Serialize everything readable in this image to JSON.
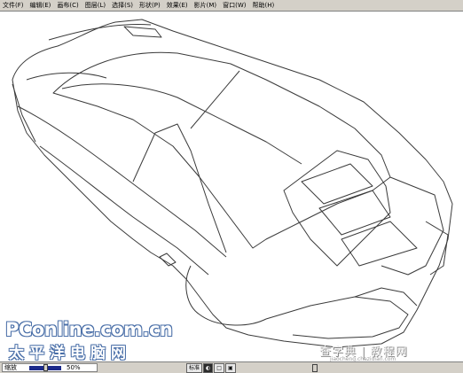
{
  "menubar": {
    "items": [
      "文件(F)",
      "编辑(E)",
      "画布(C)",
      "图层(L)",
      "选择(S)",
      "形状(P)",
      "效果(E)",
      "影片(M)",
      "窗口(W)",
      "帮助(H)"
    ]
  },
  "statusbar": {
    "zoom_label": "缩放",
    "zoom_percent": "50%",
    "zoom_level": 0.5,
    "dock_buttons": [
      "标准",
      "◐",
      "□",
      "▣"
    ]
  },
  "watermarks": {
    "site_logo": "PConline.com.cn",
    "site_slogan": "太平洋电脑网",
    "right_logo": "查字典 | 教程网",
    "right_url": "jiaocheng.chazidian.com"
  },
  "colors": {
    "chrome": "#d4d0c8",
    "line": "#3a3a3a",
    "accent": "#1c2a8a"
  }
}
